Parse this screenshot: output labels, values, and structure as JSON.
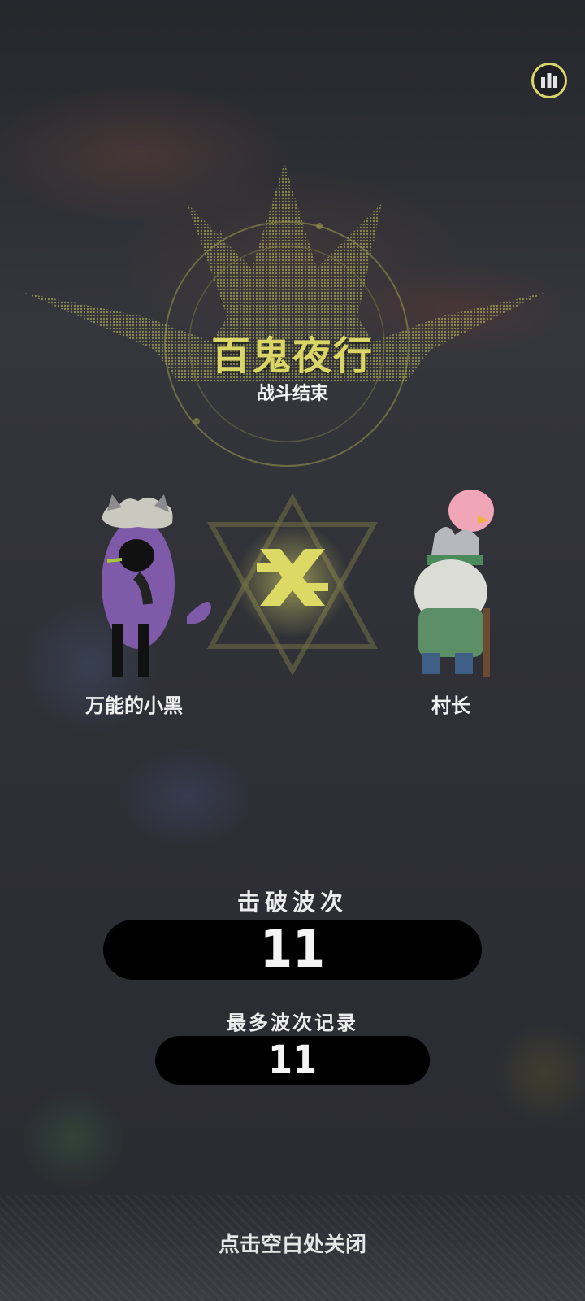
{
  "header": {
    "stats_icon": "bar-chart-icon"
  },
  "result": {
    "title": "百鬼夜行",
    "subtitle": "战斗结束"
  },
  "battle": {
    "left_player": {
      "name": "万能的小黑"
    },
    "vs_icon": "crossed-swords-icon",
    "right_player": {
      "name": "村长"
    }
  },
  "stats": {
    "waves_cleared_label": "击破波次",
    "waves_cleared_value": "11",
    "best_record_label": "最多波次记录",
    "best_record_value": "11"
  },
  "footer": {
    "close_hint": "点击空白处关闭"
  },
  "colors": {
    "accent": "#d9d566",
    "pill_bg": "#000000",
    "text": "#f0f0f0"
  }
}
